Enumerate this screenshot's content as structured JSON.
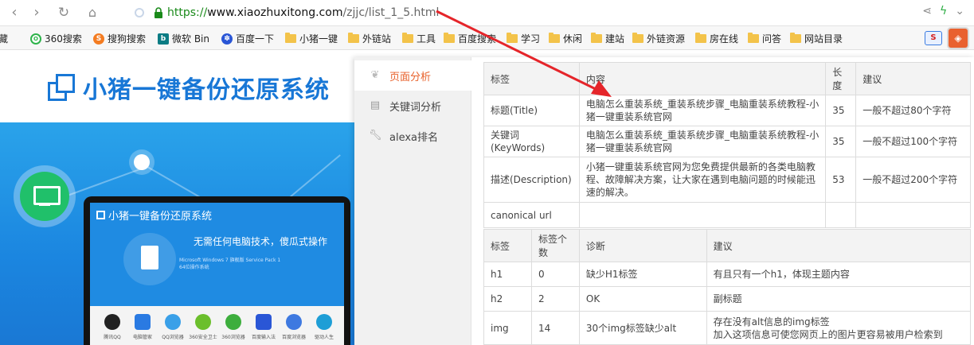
{
  "browser": {
    "url_scheme": "https://",
    "url_host": "www.xiaozhuxitong.com",
    "url_path": "/zjjc/list_1_5.html",
    "bookmarks": [
      {
        "label": "藏",
        "icon": "cut-off-text"
      },
      {
        "label": "360搜索",
        "icon": "360-icon"
      },
      {
        "label": "搜狗搜索",
        "icon": "sogou-icon"
      },
      {
        "label": "微软 Bin",
        "icon": "bing-icon"
      },
      {
        "label": "百度一下",
        "icon": "baidu-icon"
      },
      {
        "label": "小猪一键",
        "icon": "folder-icon"
      },
      {
        "label": "外链站",
        "icon": "folder-icon"
      },
      {
        "label": "工具",
        "icon": "folder-icon"
      },
      {
        "label": "百度搜索",
        "icon": "folder-icon"
      },
      {
        "label": "学习",
        "icon": "folder-icon"
      },
      {
        "label": "休闲",
        "icon": "folder-icon"
      },
      {
        "label": "建站",
        "icon": "folder-icon"
      },
      {
        "label": "外链资源",
        "icon": "folder-icon"
      },
      {
        "label": "房在线",
        "icon": "folder-icon"
      },
      {
        "label": "问答",
        "icon": "folder-icon"
      },
      {
        "label": "网站目录",
        "icon": "folder-icon"
      }
    ]
  },
  "site": {
    "brand_title": "小猪一键备份还原系统",
    "laptop_title": "小猪一键备份还原系统",
    "laptop_slogan": "无需任何电脑技术，傻瓜式操作",
    "laptop_small_1": "Microsoft Windows 7 旗舰版 Service Pack 1",
    "laptop_small_2": "64位操作系统",
    "apps": [
      "腾讯QQ",
      "电脑管家",
      "QQ浏览器",
      "360安全卫士",
      "360浏览器",
      "百度输入法",
      "百度浏览器",
      "驱动人生"
    ]
  },
  "panel": {
    "tabs": [
      {
        "label": "页面分析",
        "icon": "leaf-icon"
      },
      {
        "label": "关键词分析",
        "icon": "text-box-icon"
      },
      {
        "label": "alexa排名",
        "icon": "wrench-icon"
      }
    ],
    "meta_table": {
      "headers": [
        "标签",
        "内容",
        "长度",
        "建议"
      ],
      "rows": [
        [
          "标题(Title)",
          "电脑怎么重装系统_重装系统步骤_电脑重装系统教程-小猪一键重装系统官网",
          "35",
          "一般不超过80个字符"
        ],
        [
          "关键词(KeyWords)",
          "电脑怎么重装系统_重装系统步骤_电脑重装系统教程-小猪一键重装系统官网",
          "35",
          "一般不超过100个字符"
        ],
        [
          "描述(Description)",
          "小猪一键重装系统官网为您免费提供最新的各类电脑教程、故障解决方案，让大家在遇到电脑问题的时候能迅速的解决。",
          "53",
          "一般不超过200个字符"
        ],
        [
          "canonical url",
          "",
          "",
          ""
        ]
      ]
    },
    "tag_table": {
      "headers": [
        "标签",
        "标签个数",
        "诊断",
        "建议"
      ],
      "rows": [
        [
          "h1",
          "0",
          "缺少H1标签",
          "有且只有一个h1，体现主题内容"
        ],
        [
          "h2",
          "2",
          "OK",
          "副标题"
        ],
        [
          "img",
          "14",
          "30个img标签缺少alt",
          "存在没有alt信息的img标签\n加入这项信息可使您网页上的图片更容易被用户检索到"
        ]
      ]
    }
  }
}
